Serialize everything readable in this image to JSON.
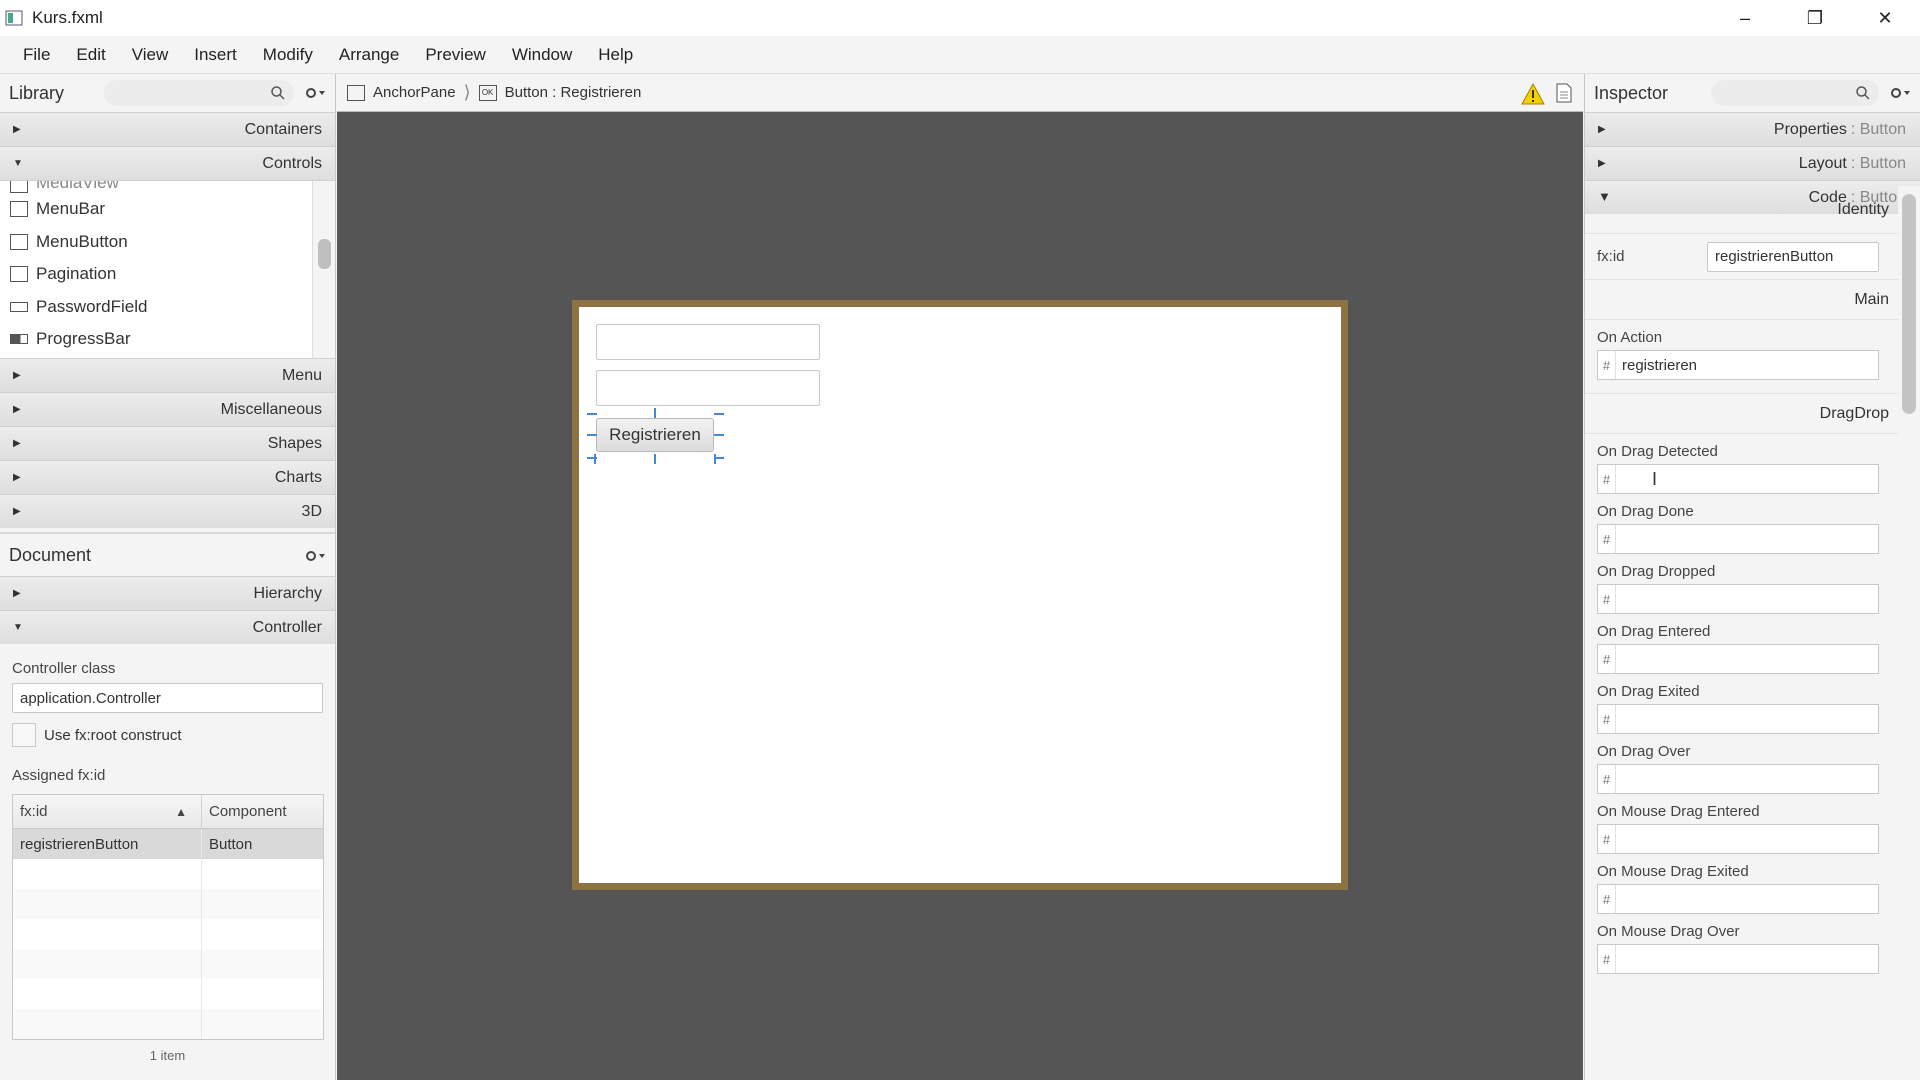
{
  "window": {
    "title": "Kurs.fxml"
  },
  "menu": [
    "File",
    "Edit",
    "View",
    "Insert",
    "Modify",
    "Arrange",
    "Preview",
    "Window",
    "Help"
  ],
  "library": {
    "title": "Library",
    "sections_top": [
      "Containers",
      "Controls"
    ],
    "items": [
      "MenuBar",
      "MenuButton",
      "Pagination",
      "PasswordField",
      "ProgressBar"
    ],
    "partial_item": "MediaView",
    "sections_bottom": [
      "Menu",
      "Miscellaneous",
      "Shapes",
      "Charts",
      "3D"
    ]
  },
  "document": {
    "title": "Document",
    "sections": [
      "Hierarchy",
      "Controller"
    ],
    "controller_class_label": "Controller class",
    "controller_class_value": "application.Controller",
    "fxroot_label": "Use fx:root construct",
    "assigned_label": "Assigned fx:id",
    "table_headers": [
      "fx:id",
      "Component"
    ],
    "rows": [
      {
        "fxid": "registrierenButton",
        "component": "Button"
      }
    ],
    "item_count": "1 item"
  },
  "breadcrumb": {
    "root": "AnchorPane",
    "current": "Button : Registrieren"
  },
  "canvas": {
    "button_label": "Registrieren"
  },
  "inspector": {
    "title": "Inspector",
    "sections": [
      {
        "name": "Properties",
        "sub": ": Button"
      },
      {
        "name": "Layout",
        "sub": ": Button"
      },
      {
        "name": "Code",
        "sub": ": Button"
      }
    ],
    "identity_title": "Identity",
    "fxid_label": "fx:id",
    "fxid_value": "registrierenButton",
    "main_title": "Main",
    "on_action_label": "On Action",
    "on_action_value": "registrieren",
    "dragdrop_title": "DragDrop",
    "drag_fields": [
      "On Drag Detected",
      "On Drag Done",
      "On Drag Dropped",
      "On Drag Entered",
      "On Drag Exited",
      "On Drag Over",
      "On Mouse Drag Entered",
      "On Mouse Drag Exited",
      "On Mouse Drag Over"
    ]
  }
}
